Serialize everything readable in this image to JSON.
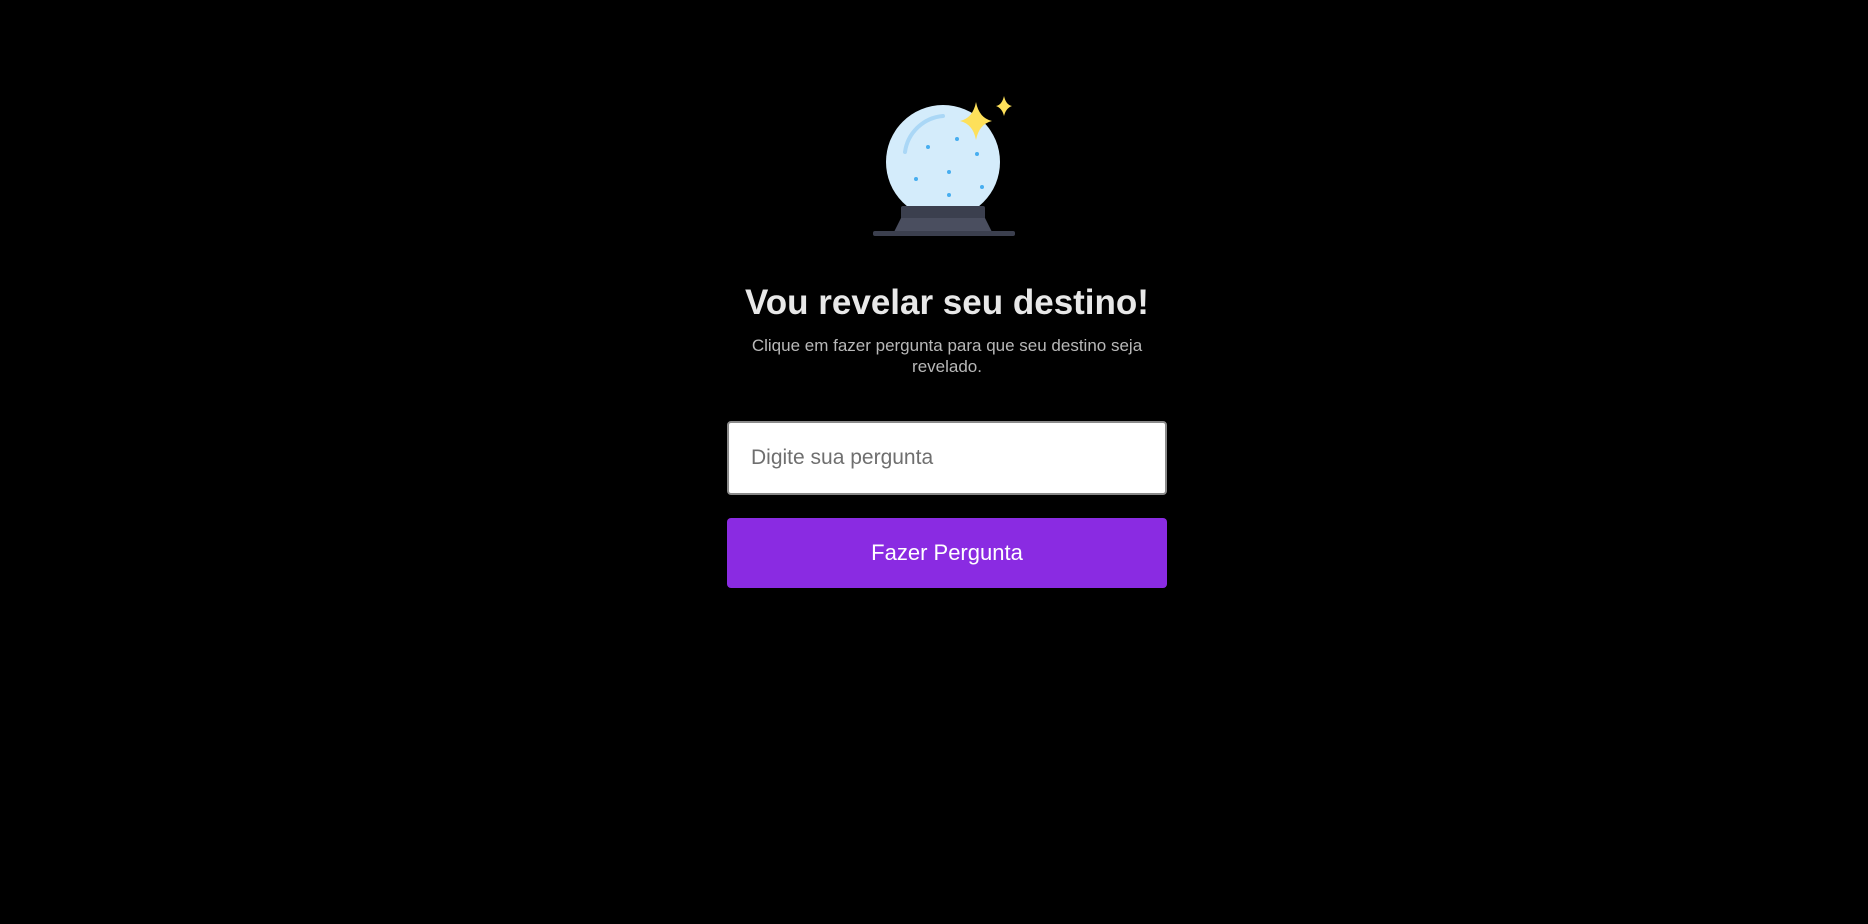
{
  "hero": {
    "icon": "crystal-ball-icon",
    "title": "Vou revelar seu destino!",
    "subtitle": "Clique em fazer pergunta para que seu destino seja revelado."
  },
  "form": {
    "question_placeholder": "Digite sua pergunta",
    "question_value": "",
    "ask_label": "Fazer Pergunta"
  },
  "colors": {
    "background": "#000000",
    "accent": "#8a2be2",
    "title": "#e8e8e8",
    "subtitle": "#b8b8b8",
    "sparkle": "#fde05a",
    "orb": "#d4ecfb"
  }
}
